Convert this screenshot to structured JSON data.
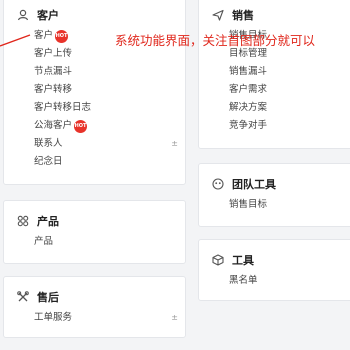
{
  "annotation": "系统功能界面，关注首图部分就可以",
  "hot_label": "HOT",
  "customer": {
    "title": "客户",
    "items": [
      {
        "label": "客户",
        "hot": true
      },
      {
        "label": "客户上传"
      },
      {
        "label": "节点漏斗"
      },
      {
        "label": "客户转移"
      },
      {
        "label": "客户转移日志"
      },
      {
        "label": "公海客户",
        "hot": true
      },
      {
        "label": "联系人",
        "pinned": true
      },
      {
        "label": "纪念日"
      }
    ]
  },
  "sales": {
    "title": "销售",
    "items": [
      {
        "label": "销售目标"
      },
      {
        "label": "目标管理"
      },
      {
        "label": "销售漏斗"
      },
      {
        "label": "客户需求"
      },
      {
        "label": "解决方案"
      },
      {
        "label": "竞争对手"
      }
    ]
  },
  "product": {
    "title": "产品",
    "items": [
      {
        "label": "产品"
      }
    ]
  },
  "team_tools": {
    "title": "团队工具",
    "items": [
      {
        "label": "销售目标"
      }
    ]
  },
  "aftersales": {
    "title": "售后",
    "items": [
      {
        "label": "工单服务",
        "pinned": true
      }
    ]
  },
  "tools": {
    "title": "工具",
    "items": [
      {
        "label": "黑名单"
      }
    ]
  },
  "pin_glyph": "±",
  "colors": {
    "annotation": "#e0261b",
    "hot_badge": "#e8332a"
  }
}
